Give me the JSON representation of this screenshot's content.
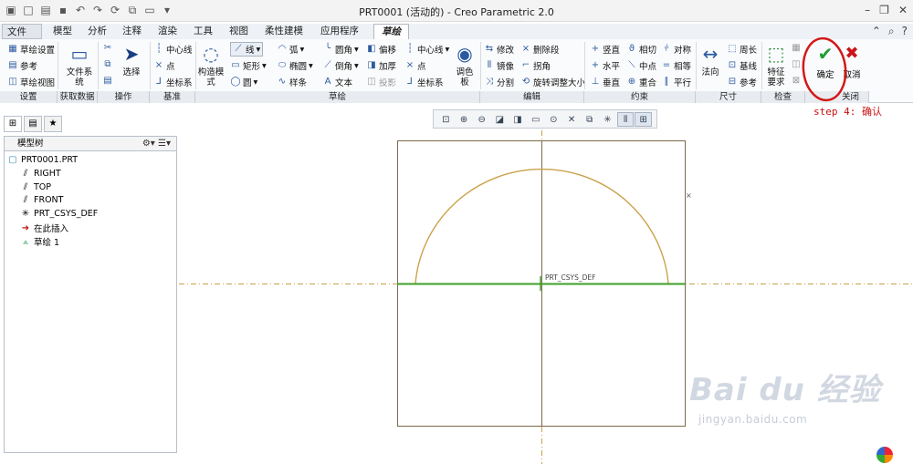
{
  "window": {
    "title": "PRT0001 (活动的) - Creo Parametric 2.0"
  },
  "tabs": [
    "文件",
    "模型",
    "分析",
    "注释",
    "渲染",
    "工具",
    "视图",
    "柔性建模",
    "应用程序",
    "草绘"
  ],
  "ribbon": {
    "settings": {
      "sketch_setup": "草绘设置",
      "reference": "参考",
      "sketch_view": "草绘视图",
      "group": "设置"
    },
    "get_data": {
      "file_system": "文件系统",
      "group": "获取数据"
    },
    "operations": {
      "select": "选择",
      "group": "操作"
    },
    "datum": {
      "centerline": "中心线",
      "point": "点",
      "csys": "坐标系",
      "group": "基准"
    },
    "sketch": {
      "construction": "构造模式",
      "line": "线",
      "arc": "弧",
      "fillet": "圆角",
      "offset": "偏移",
      "rectangle": "矩形",
      "ellipse": "椭圆",
      "chamfer": "倒角",
      "thicken": "加厚",
      "circle": "圆",
      "spline": "样条",
      "text": "文本",
      "project": "投影",
      "centerline": "中心线",
      "point": "点",
      "csys": "坐标系",
      "palette": "调色板",
      "group": "草绘"
    },
    "edit": {
      "modify": "修改",
      "delete_segment": "删除段",
      "mirror": "镜像",
      "corner": "拐角",
      "divide": "分割",
      "rotate_resize": "旋转调整大小",
      "group": "编辑"
    },
    "constrain": {
      "vertical": "竖直",
      "tangent": "相切",
      "symmetric": "对称",
      "horizontal": "水平",
      "midpoint": "中点",
      "equal": "相等",
      "perpendicular": "垂直",
      "coincident": "重合",
      "parallel": "平行",
      "group": "约束"
    },
    "dimension": {
      "normal": "法向",
      "perimeter": "周长",
      "baseline": "基线",
      "reference": "参考",
      "group": "尺寸"
    },
    "inspect": {
      "feature_req": "特征要求",
      "group": "检查"
    },
    "close": {
      "ok": "确定",
      "cancel": "取消",
      "group": "关闭"
    }
  },
  "model_tree": {
    "title": "模型树",
    "items": [
      "PRT0001.PRT",
      "RIGHT",
      "TOP",
      "FRONT",
      "PRT_CSYS_DEF",
      "在此插入",
      "草绘 1"
    ]
  },
  "graphics": {
    "csys_label": "PRT_CSYS_DEF"
  },
  "annotation": {
    "text": "step 4: 确认",
    "color": "#c81010"
  },
  "watermark": {
    "brand": "Bai du 经验",
    "url": "jingyan.baidu.com"
  },
  "colors": {
    "sketch_arc": "#c9a24a",
    "constraint_line": "#3f9f2a",
    "datum_plane": "#6b5a3a",
    "ok_check": "#1d9c2e",
    "cancel_x": "#c8141a"
  }
}
